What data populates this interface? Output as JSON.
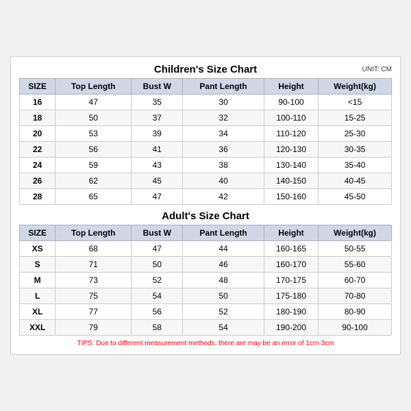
{
  "unit": "UNIT: CM",
  "children": {
    "title": "Children's Size Chart",
    "headers": [
      "SIZE",
      "Top Length",
      "Bust W",
      "Pant Length",
      "Height",
      "Weight(kg)"
    ],
    "rows": [
      [
        "16",
        "47",
        "35",
        "30",
        "90-100",
        "<15"
      ],
      [
        "18",
        "50",
        "37",
        "32",
        "100-110",
        "15-25"
      ],
      [
        "20",
        "53",
        "39",
        "34",
        "110-120",
        "25-30"
      ],
      [
        "22",
        "56",
        "41",
        "36",
        "120-130",
        "30-35"
      ],
      [
        "24",
        "59",
        "43",
        "38",
        "130-140",
        "35-40"
      ],
      [
        "26",
        "62",
        "45",
        "40",
        "140-150",
        "40-45"
      ],
      [
        "28",
        "65",
        "47",
        "42",
        "150-160",
        "45-50"
      ]
    ]
  },
  "adults": {
    "title": "Adult's Size Chart",
    "headers": [
      "SIZE",
      "Top Length",
      "Bust W",
      "Pant Length",
      "Height",
      "Weight(kg)"
    ],
    "rows": [
      [
        "XS",
        "68",
        "47",
        "44",
        "160-165",
        "50-55"
      ],
      [
        "S",
        "71",
        "50",
        "46",
        "160-170",
        "55-60"
      ],
      [
        "M",
        "73",
        "52",
        "48",
        "170-175",
        "60-70"
      ],
      [
        "L",
        "75",
        "54",
        "50",
        "175-180",
        "70-80"
      ],
      [
        "XL",
        "77",
        "56",
        "52",
        "180-190",
        "80-90"
      ],
      [
        "XXL",
        "79",
        "58",
        "54",
        "190-200",
        "90-100"
      ]
    ]
  },
  "tips": "TIPS: Due to different measurement methods, there are may be an error of 1cm-3cm"
}
